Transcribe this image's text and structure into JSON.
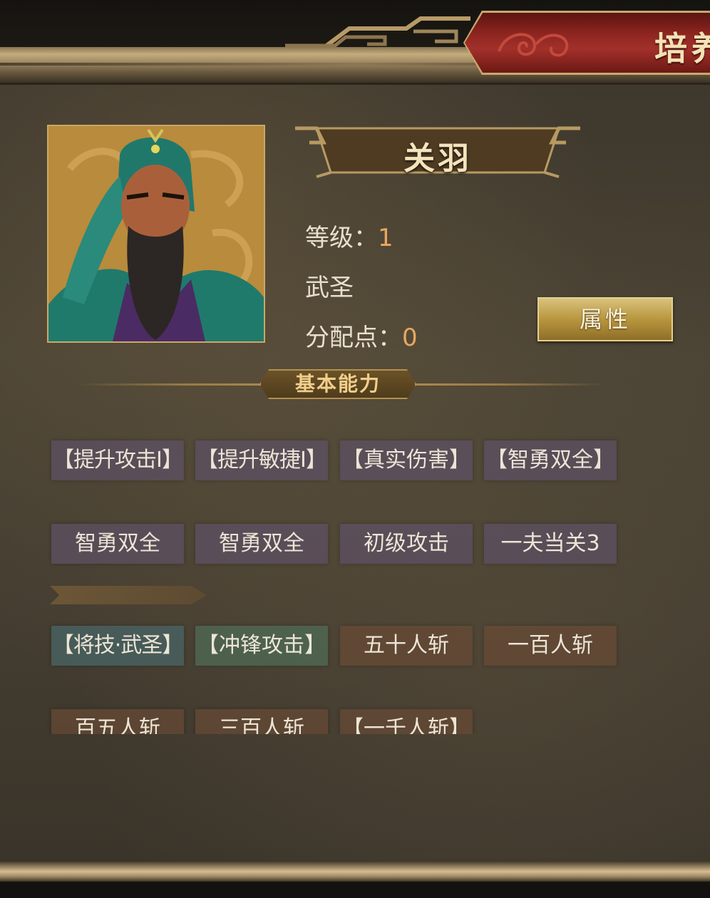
{
  "header": {
    "title": "培养"
  },
  "hero": {
    "name": "关羽",
    "level_label": "等级：",
    "level_value": "1",
    "title": "武圣",
    "points_label": "分配点：",
    "points_value": "0",
    "attributes_button": "属性"
  },
  "section": {
    "basic_ability": "基本能力"
  },
  "skills": [
    [
      "【提升攻击Ⅰ】",
      "【提升敏捷Ⅰ】",
      "【真实伤害】",
      "【智勇双全】"
    ],
    [
      "智勇双全",
      "智勇双全",
      "初级攻击",
      "一夫当关3"
    ],
    [
      "【将技·武圣】",
      "【冲锋攻击】",
      "五十人斩",
      "一百人斩"
    ],
    [
      "百五人斩",
      "三百人斩",
      "【一千人斩】"
    ]
  ],
  "colors": {
    "accent_orange": "#e9a662",
    "gold_text": "#f1cf8a",
    "banner_red": "#8e2520"
  }
}
